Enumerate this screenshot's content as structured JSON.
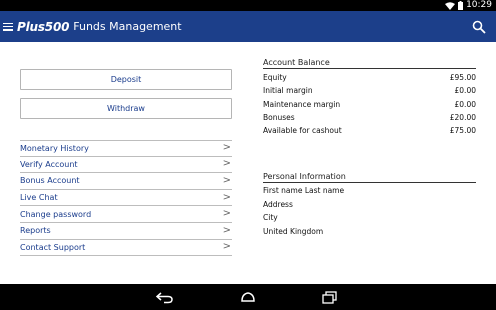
{
  "status_bar": {
    "time": "10:29"
  },
  "app_bar": {
    "logo": "Plus500",
    "title": "Funds Management"
  },
  "actions": {
    "deposit_label": "Deposit",
    "withdraw_label": "Withdraw"
  },
  "menu": {
    "items": [
      {
        "label": "Monetary History"
      },
      {
        "label": "Verify Account"
      },
      {
        "label": "Bonus Account"
      },
      {
        "label": "Live Chat"
      },
      {
        "label": "Change password"
      },
      {
        "label": "Reports"
      },
      {
        "label": "Contact Support"
      }
    ],
    "chevron": ">"
  },
  "account_balance": {
    "title": "Account Balance",
    "rows": [
      {
        "label": "Equity",
        "value": "£95.00"
      },
      {
        "label": "Initial margin",
        "value": "£0.00"
      },
      {
        "label": "Maintenance margin",
        "value": "£0.00"
      },
      {
        "label": "Bonuses",
        "value": "£20.00"
      },
      {
        "label": "Available for cashout",
        "value": "£75.00"
      }
    ]
  },
  "personal_information": {
    "title": "Personal Information",
    "rows": [
      {
        "text": "First name Last name"
      },
      {
        "text": "Address"
      },
      {
        "text": "City"
      },
      {
        "text": "United Kingdom"
      }
    ]
  },
  "colors": {
    "app_bar": "#1c3f8a",
    "link": "#1a3c8c"
  }
}
